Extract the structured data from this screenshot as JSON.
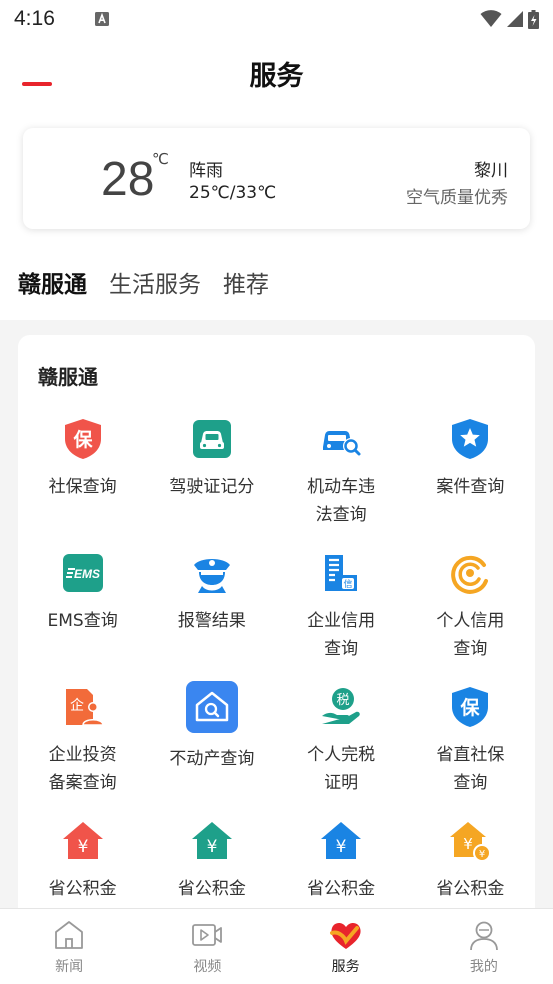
{
  "status": {
    "time": "4:16"
  },
  "header": {
    "title": "服务"
  },
  "weather": {
    "temp": "28",
    "unit": "℃",
    "condition": "阵雨",
    "range": "25℃/33℃",
    "location": "黎川",
    "air_quality": "空气质量优秀"
  },
  "tabs": [
    {
      "label": "赣服通",
      "active": true
    },
    {
      "label": "生活服务",
      "active": false
    },
    {
      "label": "推荐",
      "active": false
    }
  ],
  "section": {
    "title": "赣服通"
  },
  "services": [
    {
      "label": "社保查询",
      "icon": "shield-bao-icon",
      "color": "#f0544a"
    },
    {
      "label": "驾驶证记分",
      "icon": "car-icon",
      "color": "#1ea08a"
    },
    {
      "label": "机动车违\n法查询",
      "icon": "car-search-icon",
      "color": "#1a84e3"
    },
    {
      "label": "案件查询",
      "icon": "shield-star-icon",
      "color": "#1a84e3"
    },
    {
      "label": "EMS查询",
      "icon": "ems-icon",
      "color": "#1ea08a"
    },
    {
      "label": "报警结果",
      "icon": "police-icon",
      "color": "#1a84e3"
    },
    {
      "label": "企业信用\n查询",
      "icon": "building-credit-icon",
      "color": "#1a84e3"
    },
    {
      "label": "个人信用\n查询",
      "icon": "credit-circle-icon",
      "color": "#f5a623"
    },
    {
      "label": "企业投资\n备案查询",
      "icon": "enterprise-investment-icon",
      "color": "#f26b3a"
    },
    {
      "label": "不动产查询",
      "icon": "house-search-icon",
      "color": "#3a86f0"
    },
    {
      "label": "个人完税\n证明",
      "icon": "tax-hand-icon",
      "color": "#1ea08a"
    },
    {
      "label": "省直社保\n查询",
      "icon": "shield-bao-icon",
      "color": "#1a84e3"
    },
    {
      "label": "省公积金",
      "icon": "house-yuan-icon",
      "color": "#f0544a"
    },
    {
      "label": "省公积金",
      "icon": "house-yuan-icon",
      "color": "#1ea08a"
    },
    {
      "label": "省公积金",
      "icon": "house-yuan-icon",
      "color": "#1a84e3"
    },
    {
      "label": "省公积金",
      "icon": "house-yuan-icon",
      "color": "#f5a623"
    }
  ],
  "nav": [
    {
      "label": "新闻",
      "icon": "house-outline-icon",
      "active": false
    },
    {
      "label": "视频",
      "icon": "video-icon",
      "active": false
    },
    {
      "label": "服务",
      "icon": "heart-check-icon",
      "active": true
    },
    {
      "label": "我的",
      "icon": "user-icon",
      "active": false
    }
  ],
  "colors": {
    "accent": "#e8242c"
  }
}
